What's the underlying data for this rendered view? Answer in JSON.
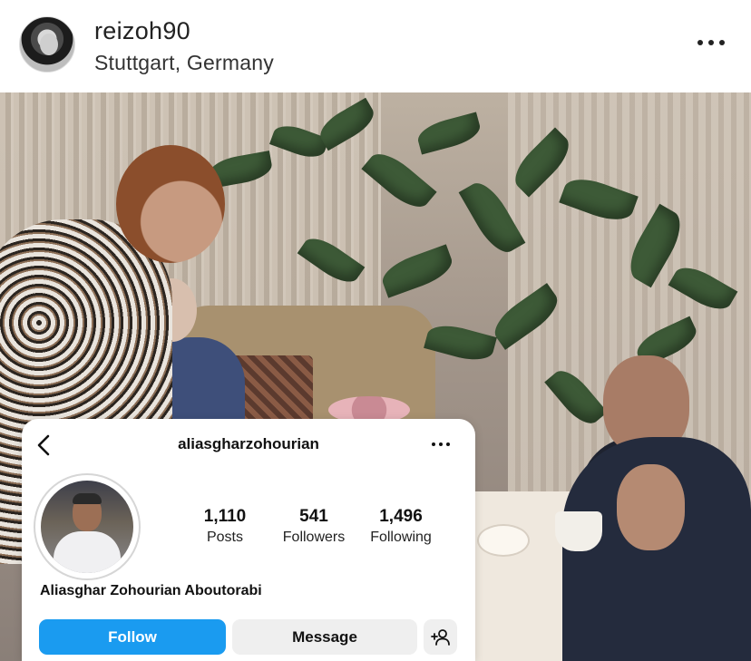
{
  "post": {
    "username": "reizoh90",
    "location": "Stuttgart, Germany",
    "more_icon": "more-horizontal-icon"
  },
  "profile_card": {
    "username": "aliasgharzohourian",
    "full_name": "Aliasghar Zohourian Aboutorabi",
    "stats": {
      "posts_count": "1,110",
      "posts_label": "Posts",
      "followers_count": "541",
      "followers_label": "Followers",
      "following_count": "1,496",
      "following_label": "Following"
    },
    "buttons": {
      "follow_label": "Follow",
      "message_label": "Message"
    },
    "icons": {
      "back": "chevron-left-icon",
      "more": "more-horizontal-icon",
      "add_user": "add-user-icon"
    },
    "colors": {
      "follow_button": "#1a9bf0",
      "secondary_button": "#efefef"
    }
  }
}
